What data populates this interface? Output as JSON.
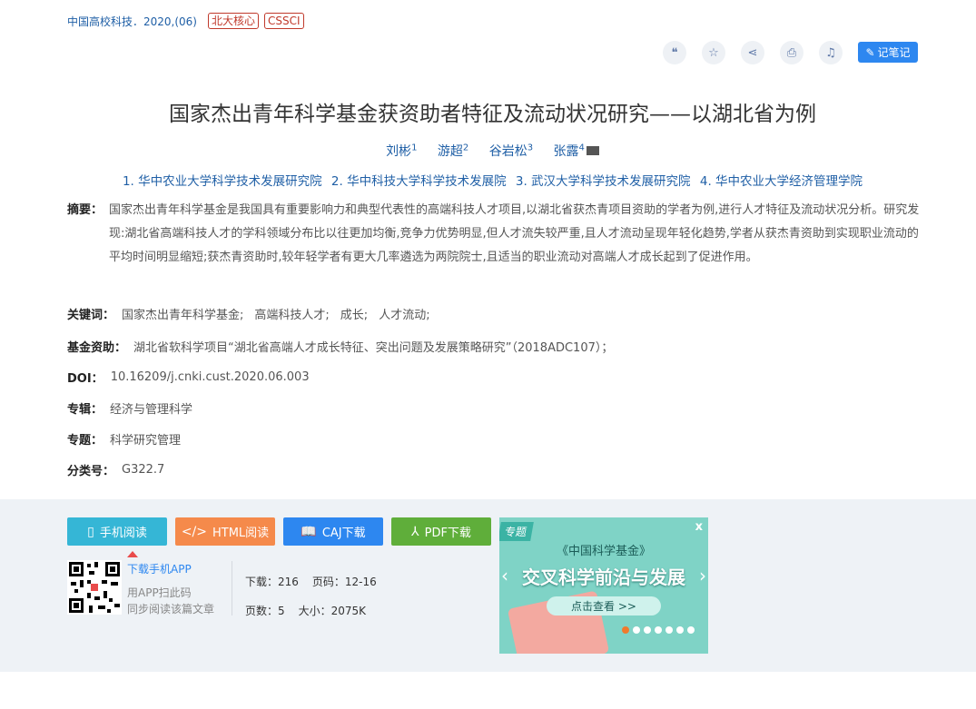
{
  "source": {
    "journal": "中国高校科技．2020,(06)",
    "badges": [
      "北大核心",
      "CSSCI"
    ]
  },
  "tools": {
    "icons": [
      "quote-icon",
      "star-icon",
      "share-icon",
      "print-icon",
      "bell-icon"
    ],
    "note_label": "记笔记"
  },
  "title": "国家杰出青年科学基金获资助者特征及流动状况研究——以湖北省为例",
  "authors": [
    {
      "name": "刘彬",
      "sup": "1"
    },
    {
      "name": "游超",
      "sup": "2"
    },
    {
      "name": "谷岩松",
      "sup": "3"
    },
    {
      "name": "张露",
      "sup": "4"
    }
  ],
  "orgs": [
    "1. 华中农业大学科学技术发展研究院",
    "2. 华中科技大学科学技术发展院",
    "3. 武汉大学科学技术发展研究院",
    "4. 华中农业大学经济管理学院"
  ],
  "abstract": {
    "label": "摘要：",
    "text": "国家杰出青年科学基金是我国具有重要影响力和典型代表性的高端科技人才项目,以湖北省获杰青项目资助的学者为例,进行人才特征及流动状况分析。研究发现:湖北省高端科技人才的学科领域分布比以往更加均衡,竞争力优势明显,但人才流失较严重,且人才流动呈现年轻化趋势,学者从获杰青资助到实现职业流动的平均时间明显缩短;获杰青资助时,较年轻学者有更大几率遴选为两院院士,且适当的职业流动对高端人才成长起到了促进作用。"
  },
  "keywords": {
    "label": "关键词：",
    "items": [
      "国家杰出青年科学基金;",
      "高端科技人才;",
      "成长;",
      "人才流动;"
    ]
  },
  "fund": {
    "label": "基金资助：",
    "text": "湖北省软科学项目“湖北省高端人才成长特征、突出问题及发展策略研究”（2018ADC107）；"
  },
  "doi": {
    "label": "DOI：",
    "text": "10.16209/j.cnki.cust.2020.06.003"
  },
  "series": {
    "label": "专辑：",
    "text": "经济与管理科学"
  },
  "subject": {
    "label": "专题：",
    "text": "科学研究管理"
  },
  "classno": {
    "label": "分类号：",
    "text": "G322.7"
  },
  "buttons": {
    "mobile": {
      "label": "手机阅读",
      "color": "#35b6d6"
    },
    "html": {
      "label": "HTML阅读",
      "color": "#f58a4b"
    },
    "caj": {
      "label": "CAJ下载",
      "color": "#2d87f0"
    },
    "pdf": {
      "label": "PDF下载",
      "color": "#5fae3a"
    }
  },
  "app": {
    "download": "下载手机APP",
    "line1": "用APP扫此码",
    "line2": "同步阅读该篇文章"
  },
  "stats": {
    "downloads": "下载：216",
    "pages_range": "页码：12-16",
    "page_count": "页数：5",
    "size": "大小：2075K"
  },
  "banner": {
    "tag": "专题",
    "close": "x",
    "line1": "《中国科学基金》",
    "line2": "交叉科学前沿与发展",
    "cta": "点击查看 >>"
  }
}
